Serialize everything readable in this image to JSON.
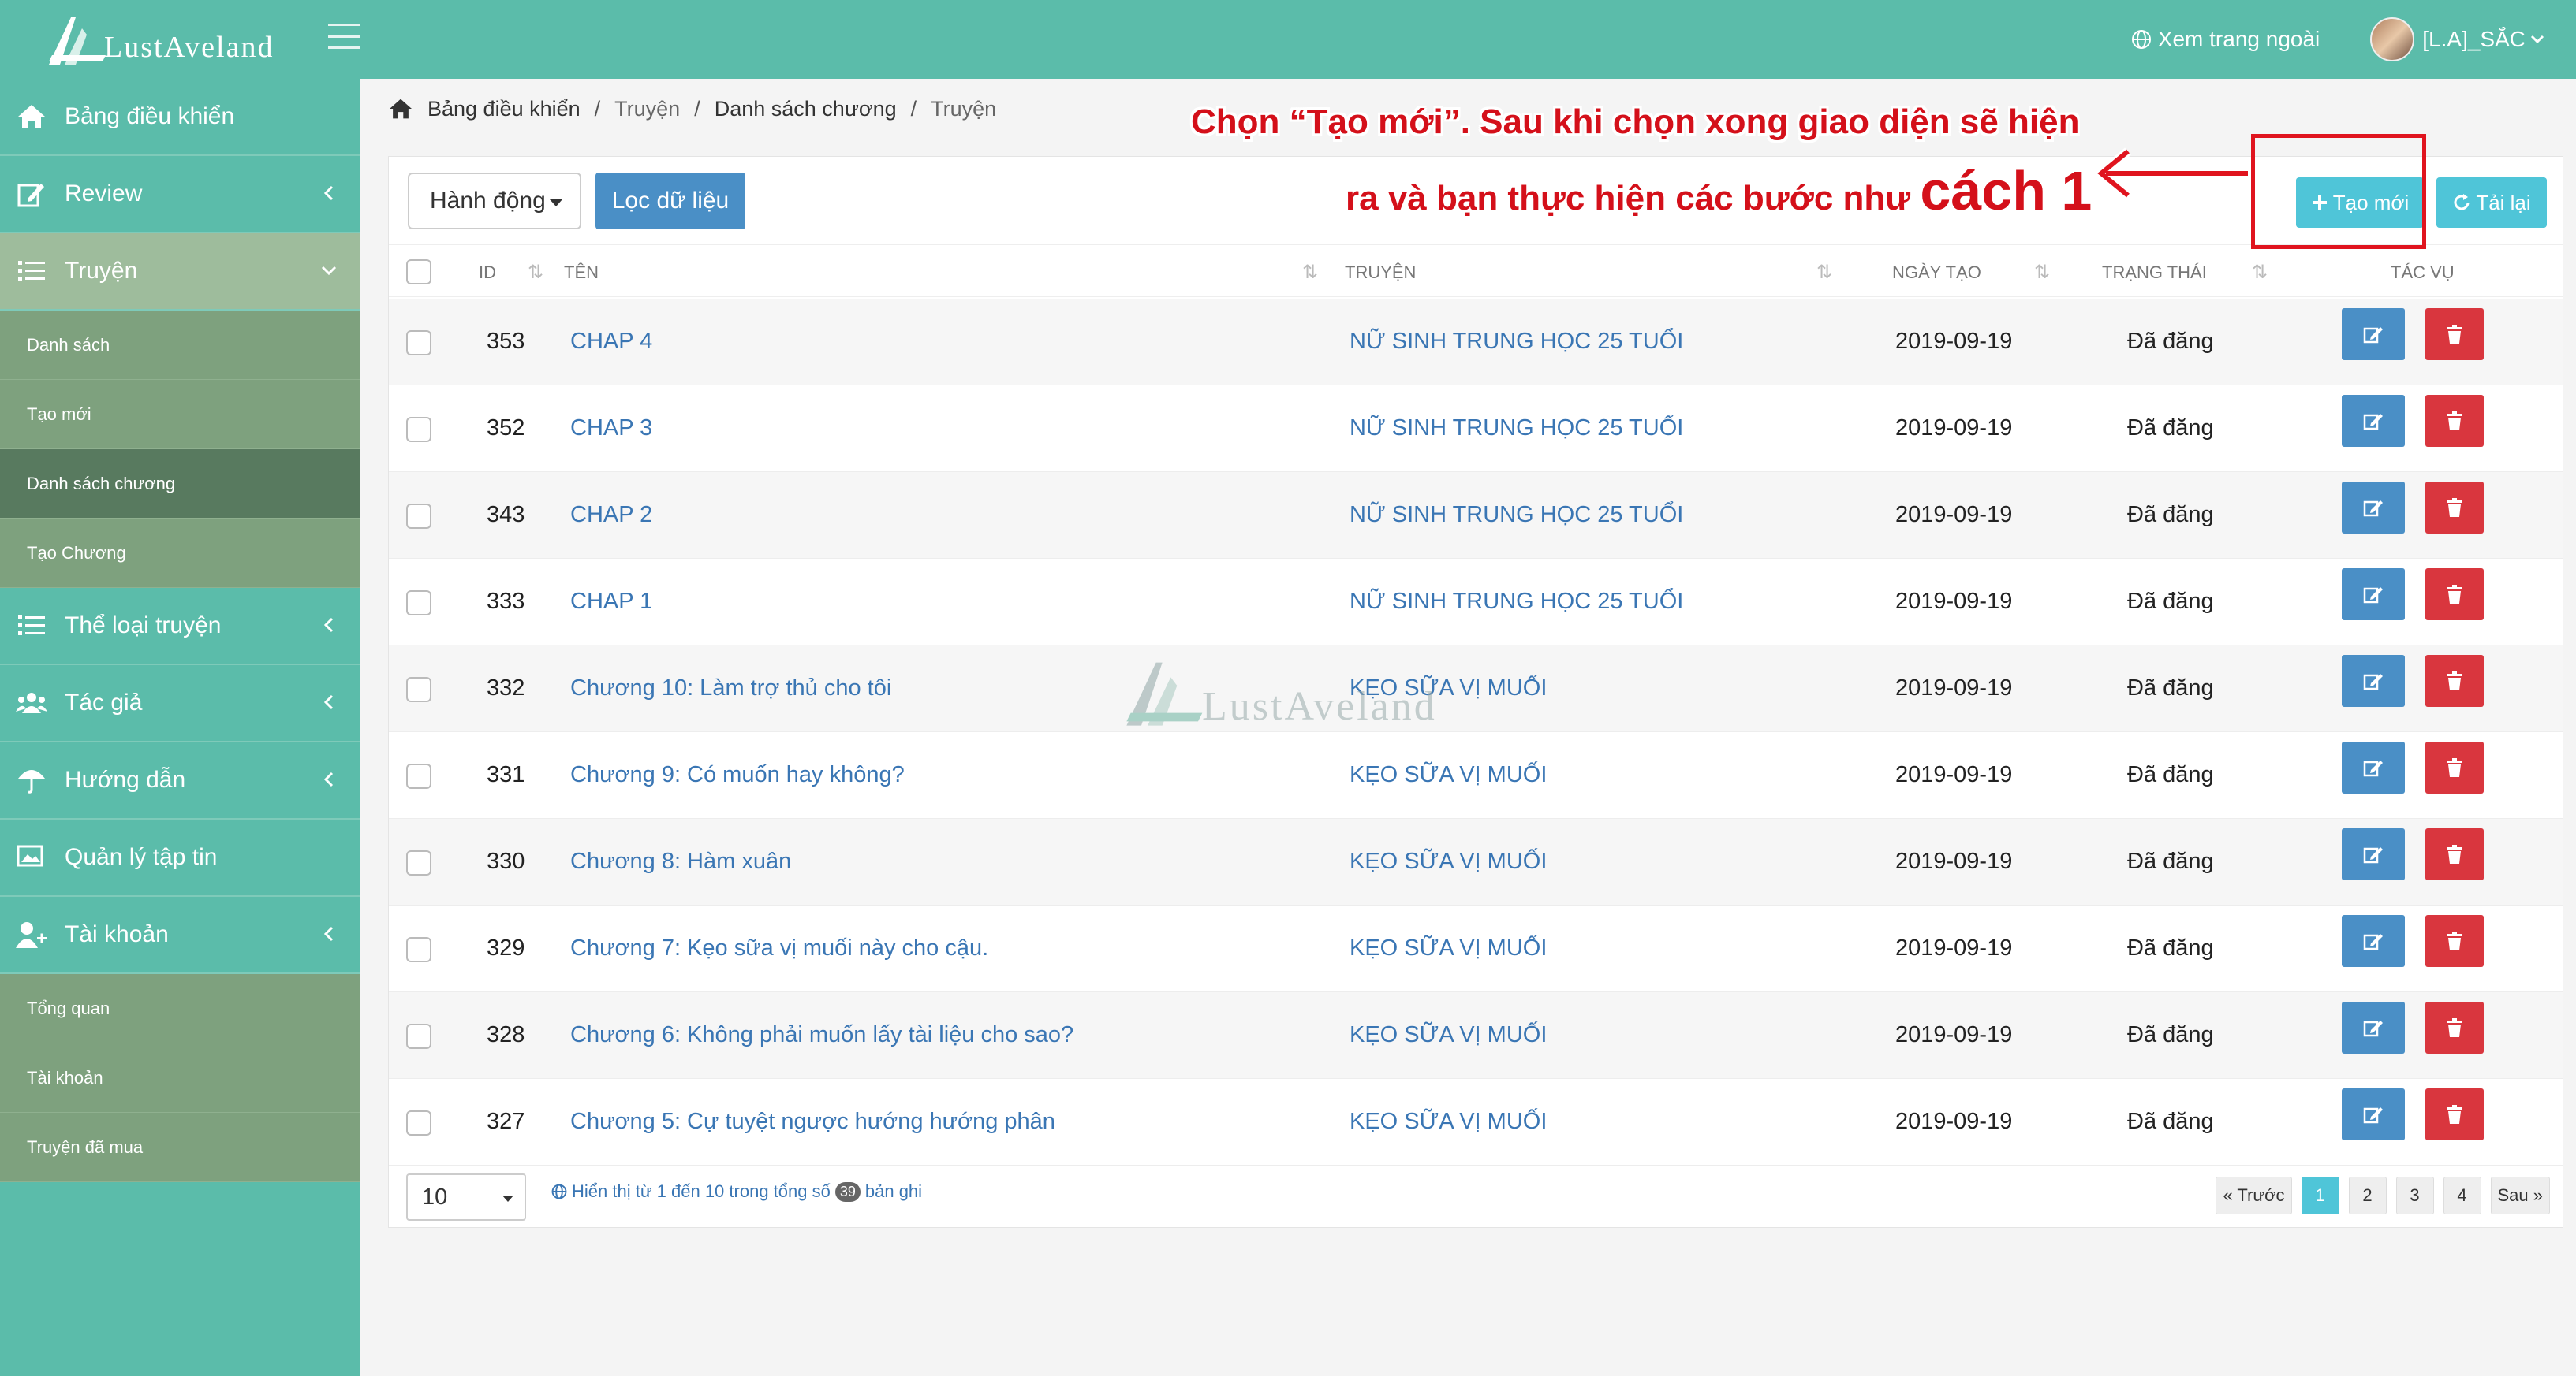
{
  "app": {
    "logo_text": "LustAveland",
    "visit_site": "Xem trang ngoài",
    "user_name": "[L.A]_SẮC"
  },
  "sidebar": {
    "items": [
      {
        "label": "Bảng điều khiển",
        "icon": "home-icon"
      },
      {
        "label": "Review",
        "icon": "edit-note-icon"
      },
      {
        "label": "Truyện",
        "icon": "list-icon"
      },
      {
        "label": "Thể loại truyện",
        "icon": "list-icon"
      },
      {
        "label": "Tác giả",
        "icon": "users-icon"
      },
      {
        "label": "Hướng dẫn",
        "icon": "umbrella-icon"
      },
      {
        "label": "Quản lý tập tin",
        "icon": "images-icon"
      },
      {
        "label": "Tài khoản",
        "icon": "user-icon"
      }
    ],
    "truyen_sub": [
      "Danh sách",
      "Tạo mới",
      "Danh sách chương",
      "Tạo Chương"
    ],
    "account_sub": [
      "Tổng quan",
      "Tài khoản",
      "Truyện đã mua"
    ]
  },
  "breadcrumb": [
    "Bảng điều khiển",
    "Truyện",
    "Danh sách chương",
    "Truyện"
  ],
  "toolbar": {
    "action_label": "Hành động",
    "filter_label": "Lọc dữ liệu",
    "create_label": "Tạo mới",
    "reload_label": "Tải lại"
  },
  "table": {
    "headers": {
      "id": "ID",
      "name": "TÊN",
      "story": "TRUYỆN",
      "date": "NGÀY TẠO",
      "status": "TRẠNG THÁI",
      "actions": "TÁC VỤ"
    },
    "rows": [
      {
        "id": "353",
        "name": "CHAP 4",
        "story": "NỮ SINH TRUNG HỌC 25 TUỔI",
        "date": "2019-09-19",
        "status": "Đã đăng"
      },
      {
        "id": "352",
        "name": "CHAP 3",
        "story": "NỮ SINH TRUNG HỌC 25 TUỔI",
        "date": "2019-09-19",
        "status": "Đã đăng"
      },
      {
        "id": "343",
        "name": "CHAP 2",
        "story": "NỮ SINH TRUNG HỌC 25 TUỔI",
        "date": "2019-09-19",
        "status": "Đã đăng"
      },
      {
        "id": "333",
        "name": "CHAP 1",
        "story": "NỮ SINH TRUNG HỌC 25 TUỔI",
        "date": "2019-09-19",
        "status": "Đã đăng"
      },
      {
        "id": "332",
        "name": "Chương 10: Làm trợ thủ cho tôi",
        "story": "KẸO SỮA VỊ MUỐI",
        "date": "2019-09-19",
        "status": "Đã đăng"
      },
      {
        "id": "331",
        "name": "Chương 9: Có muốn hay không?",
        "story": "KẸO SỮA VỊ MUỐI",
        "date": "2019-09-19",
        "status": "Đã đăng"
      },
      {
        "id": "330",
        "name": "Chương 8: Hàm xuân",
        "story": "KẸO SỮA VỊ MUỐI",
        "date": "2019-09-19",
        "status": "Đã đăng"
      },
      {
        "id": "329",
        "name": "Chương 7: Kẹo sữa vị muối này cho cậu.",
        "story": "KẸO SỮA VỊ MUỐI",
        "date": "2019-09-19",
        "status": "Đã đăng"
      },
      {
        "id": "328",
        "name": "Chương 6: Không phải muốn lấy tài liệu cho sao?",
        "story": "KẸO SỮA VỊ MUỐI",
        "date": "2019-09-19",
        "status": "Đã đăng"
      },
      {
        "id": "327",
        "name": "Chương 5: Cự tuyệt ngược hướng hướng phân",
        "story": "KẸO SỮA VỊ MUỐI",
        "date": "2019-09-19",
        "status": "Đã đăng"
      }
    ]
  },
  "footer": {
    "page_size": "10",
    "info_prefix": "Hiển thị từ 1 đến 10 trong tổng số",
    "total": "39",
    "info_suffix": "bản ghi",
    "pagination": [
      "« Trước",
      "1",
      "2",
      "3",
      "4",
      "Sau »"
    ],
    "active_page": "1"
  },
  "annotation": {
    "line1": "Chọn “Tạo mới”. Sau khi chọn xong giao diện sẽ hiện",
    "line2": "ra và bạn thực hiện các bước như",
    "line2_big": "cách 1"
  },
  "colors": {
    "sidebar": "#5bbcaa",
    "link": "#3a76b4",
    "primary": "#4a8fc6",
    "info": "#4fc5d8",
    "danger": "#d9363e",
    "annotation": "#d4101a"
  }
}
